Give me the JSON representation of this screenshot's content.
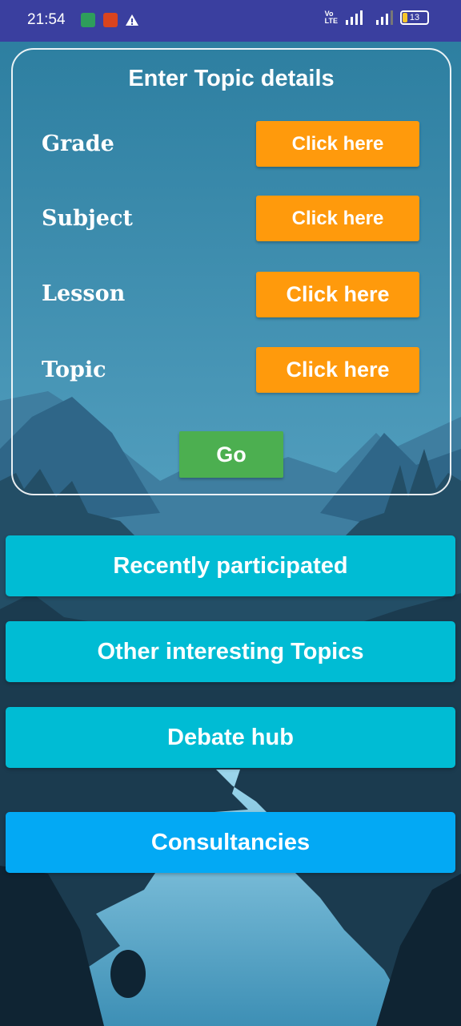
{
  "status_bar": {
    "time": "21:54",
    "battery_level": "13",
    "icons": [
      "battery-saver-icon",
      "security-icon",
      "warning-icon",
      "volte-icon",
      "signal-4g-icon",
      "signal-icon"
    ]
  },
  "topic_card": {
    "title": "Enter Topic details",
    "rows": [
      {
        "label": "Grade",
        "button": "Click here"
      },
      {
        "label": "Subject",
        "button": "Click here"
      },
      {
        "label": "Lesson",
        "button": "Click here"
      },
      {
        "label": "Topic",
        "button": "Click here"
      }
    ],
    "go_label": "Go"
  },
  "menu": {
    "recently_participated": "Recently participated",
    "other_topics": "Other interesting Topics",
    "debate_hub": "Debate hub",
    "consultancies": "Consultancies"
  },
  "colors": {
    "status_bar": "#3a3f9f",
    "orange_button": "#ff9a0c",
    "go_button": "#4caf50",
    "teal_button": "#00bcd4",
    "blue_button": "#03a9f4"
  }
}
